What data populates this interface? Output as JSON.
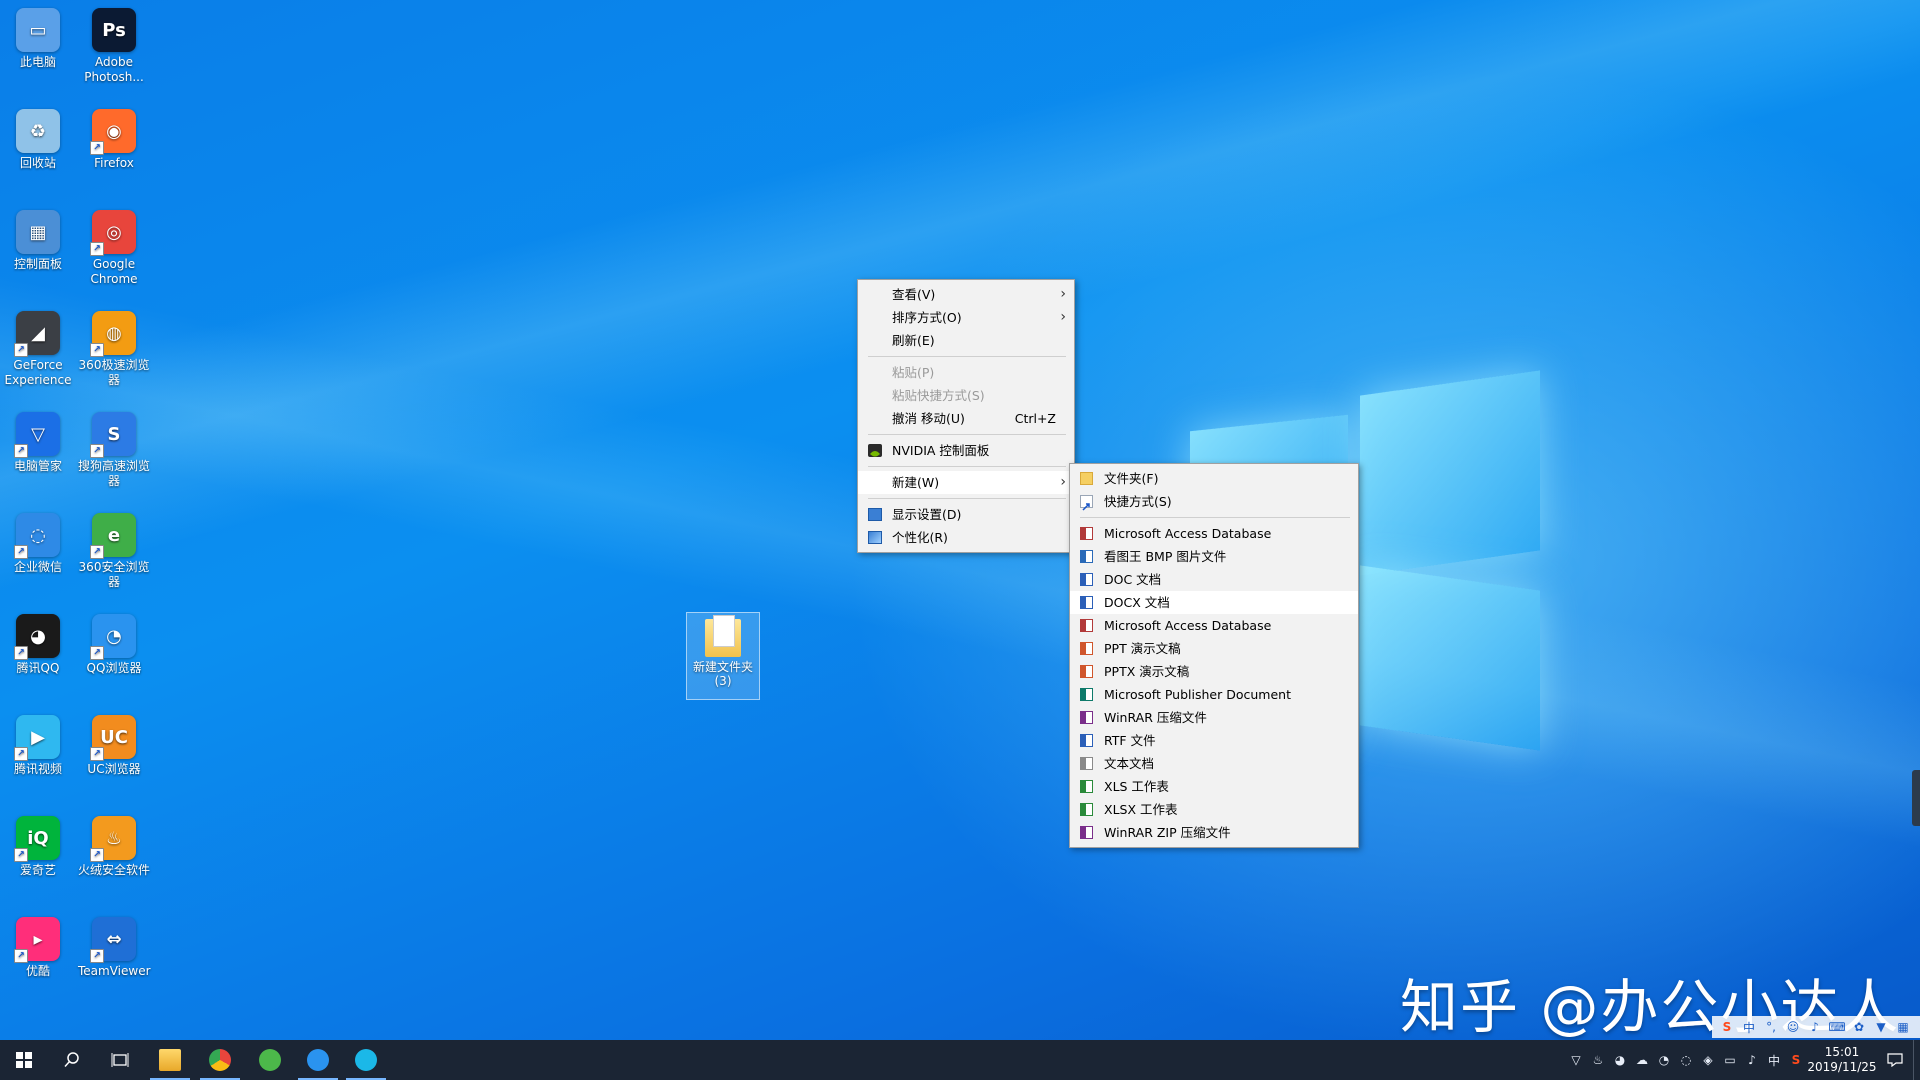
{
  "desktop_icons": [
    {
      "label": "此电脑",
      "icon": "computer-icon",
      "color": "#5aa0e8",
      "glyph": "▭"
    },
    {
      "label": "Adobe Photosh...",
      "icon": "photoshop-icon",
      "color": "#0b1a33",
      "glyph": "Ps"
    },
    {
      "label": "回收站",
      "icon": "recycle-bin-icon",
      "color": "#8fc2e8",
      "glyph": "♻"
    },
    {
      "label": "Firefox",
      "icon": "firefox-icon",
      "color": "#ff6a2b",
      "glyph": "◉"
    },
    {
      "label": "控制面板",
      "icon": "control-panel-icon",
      "color": "#4b8fd6",
      "glyph": "▦"
    },
    {
      "label": "Google Chrome",
      "icon": "chrome-icon",
      "color": "#e8453c",
      "glyph": "◎"
    },
    {
      "label": "GeForce Experience",
      "icon": "geforce-icon",
      "color": "#3b3f45",
      "glyph": "◢"
    },
    {
      "label": "360极速浏览器",
      "icon": "360-speed-browser-icon",
      "color": "#f39c12",
      "glyph": "◍"
    },
    {
      "label": "电脑管家",
      "icon": "pc-manager-icon",
      "color": "#1b6fe6",
      "glyph": "▽"
    },
    {
      "label": "搜狗高速浏览器",
      "icon": "sogou-browser-icon",
      "color": "#2c7be5",
      "glyph": "S"
    },
    {
      "label": "企业微信",
      "icon": "wecom-icon",
      "color": "#2e8ae6",
      "glyph": "◌"
    },
    {
      "label": "360安全浏览器",
      "icon": "360-safe-browser-icon",
      "color": "#3fae48",
      "glyph": "e"
    },
    {
      "label": "腾讯QQ",
      "icon": "qq-icon",
      "color": "#1a1a1a",
      "glyph": "◕"
    },
    {
      "label": "QQ浏览器",
      "icon": "qq-browser-icon",
      "color": "#2a93ef",
      "glyph": "◔"
    },
    {
      "label": "腾讯视频",
      "icon": "tencent-video-icon",
      "color": "#2fb8f0",
      "glyph": "▶"
    },
    {
      "label": "UC浏览器",
      "icon": "uc-browser-icon",
      "color": "#f28c1e",
      "glyph": "UC"
    },
    {
      "label": "爱奇艺",
      "icon": "iqiyi-icon",
      "color": "#00b43c",
      "glyph": "iQ"
    },
    {
      "label": "火绒安全软件",
      "icon": "huorong-icon",
      "color": "#f39a1e",
      "glyph": "♨"
    },
    {
      "label": "优酷",
      "icon": "youku-icon",
      "color": "#ff2e7a",
      "glyph": "▸"
    },
    {
      "label": "TeamViewer",
      "icon": "teamviewer-icon",
      "color": "#1f6fd6",
      "glyph": "⇔"
    }
  ],
  "selected_folder": {
    "label": "新建文件夹 (3)"
  },
  "context_menu": {
    "view": "查看(V)",
    "sort": "排序方式(O)",
    "refresh": "刷新(E)",
    "paste": "粘贴(P)",
    "paste_shortcut": "粘贴快捷方式(S)",
    "undo_move": "撤消 移动(U)",
    "undo_shortcut": "Ctrl+Z",
    "nvidia": "NVIDIA 控制面板",
    "new": "新建(W)",
    "display": "显示设置(D)",
    "personalize": "个性化(R)"
  },
  "submenu_new": {
    "folder": "文件夹(F)",
    "shortcut": "快捷方式(S)",
    "items": [
      {
        "label": "Microsoft Access Database",
        "icon": "access-file-icon",
        "color": "#b23a3a"
      },
      {
        "label": "看图王 BMP 图片文件",
        "icon": "bmp-file-icon",
        "color": "#2a6ab8"
      },
      {
        "label": "DOC 文档",
        "icon": "doc-file-icon",
        "color": "#2b5fb8"
      },
      {
        "label": "DOCX 文档",
        "icon": "docx-file-icon",
        "color": "#2b5fb8"
      },
      {
        "label": "Microsoft Access Database",
        "icon": "access-file-icon",
        "color": "#b23a3a"
      },
      {
        "label": "PPT 演示文稿",
        "icon": "ppt-file-icon",
        "color": "#d0552b"
      },
      {
        "label": "PPTX 演示文稿",
        "icon": "pptx-file-icon",
        "color": "#d0552b"
      },
      {
        "label": "Microsoft Publisher Document",
        "icon": "publisher-file-icon",
        "color": "#0e7a6a"
      },
      {
        "label": "WinRAR 压缩文件",
        "icon": "winrar-file-icon",
        "color": "#7a2e8a"
      },
      {
        "label": "RTF 文件",
        "icon": "rtf-file-icon",
        "color": "#2b5fb8"
      },
      {
        "label": "文本文档",
        "icon": "text-file-icon",
        "color": "#8a8a8a"
      },
      {
        "label": "XLS 工作表",
        "icon": "xls-file-icon",
        "color": "#2a8a3a"
      },
      {
        "label": "XLSX 工作表",
        "icon": "xlsx-file-icon",
        "color": "#2a8a3a"
      },
      {
        "label": "WinRAR ZIP 压缩文件",
        "icon": "winrar-zip-file-icon",
        "color": "#7a2e8a"
      }
    ]
  },
  "watermark": "知乎 @办公小达人",
  "taskbar": {
    "clock_time": "15:01",
    "clock_date": "2019/11/25",
    "ime_label": "中"
  },
  "ime_bar": {
    "lang": "中"
  },
  "colors": {
    "accent": "#0a7ee8",
    "taskbar": "#1b2534",
    "menu_bg": "#f2f2f2"
  }
}
